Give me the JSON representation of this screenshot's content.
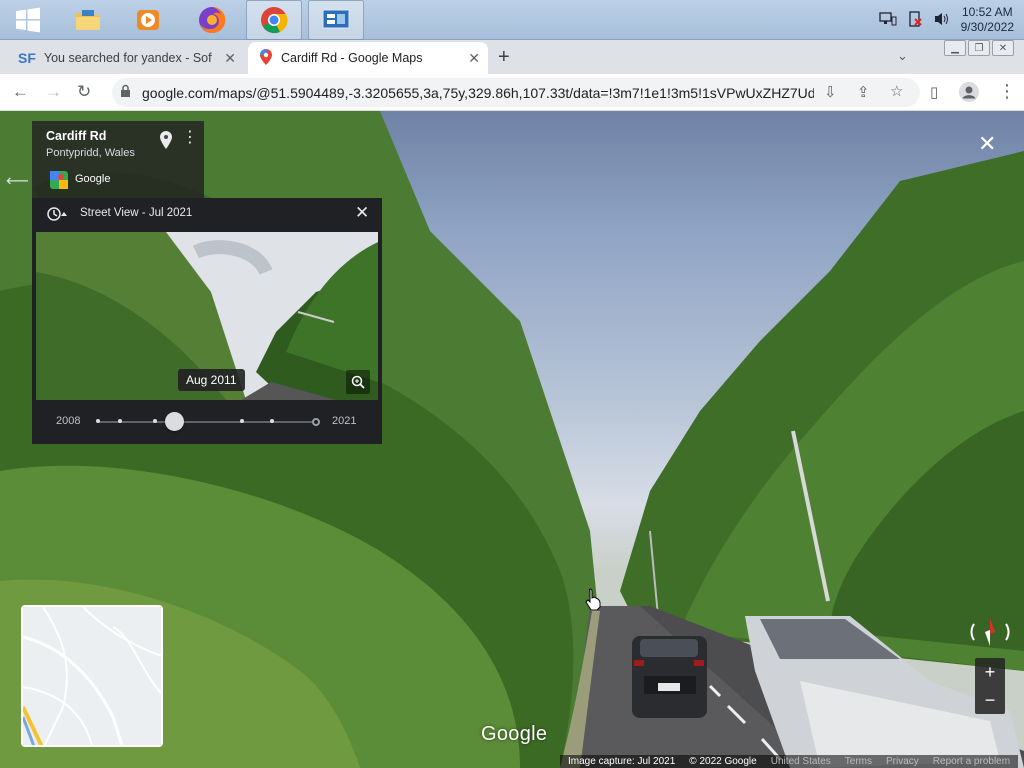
{
  "taskbar": {
    "apps": [
      "windows-start-icon",
      "file-explorer-icon",
      "media-player-icon",
      "firefox-icon",
      "chrome-icon",
      "control-panel-icon"
    ],
    "clock_time": "10:52 AM",
    "clock_date": "9/30/2022"
  },
  "tabs": [
    {
      "favicon": "SF",
      "title": "You searched for yandex - Soft Fe",
      "close": "✕"
    },
    {
      "title": "Cardiff Rd - Google Maps",
      "close": "✕"
    }
  ],
  "new_tab_label": "+",
  "address_bar": {
    "url": "google.com/maps/@51.5904489,-3.3205655,3a,75y,329.86h,107.33t/data=!3m7!1e1!3m5!1sVPwUxZHZ7Ud..."
  },
  "place": {
    "name": "Cardiff Rd",
    "locality": "Pontypridd, Wales",
    "provider": "Google"
  },
  "time_machine": {
    "header": "Street View - Jul 2021",
    "tooltip": "Aug 2011",
    "start_year": "2008",
    "end_year": "2021",
    "slider_selected_fraction": 0.35,
    "capture_dots": [
      0,
      0.1,
      0.26,
      0.35,
      0.66,
      0.8,
      1
    ]
  },
  "watermark": "Google",
  "footer": {
    "capture": "Image capture: Jul 2021",
    "copyright": "© 2022 Google",
    "country": "United States",
    "terms": "Terms",
    "privacy": "Privacy",
    "report": "Report a problem"
  },
  "zoom": {
    "in": "+",
    "out": "−"
  },
  "colors": {
    "tab_strip": "#dee1e6",
    "panel_bg": "#202124",
    "sky": "#8fa3c4",
    "foliage": "#3f6c28"
  }
}
